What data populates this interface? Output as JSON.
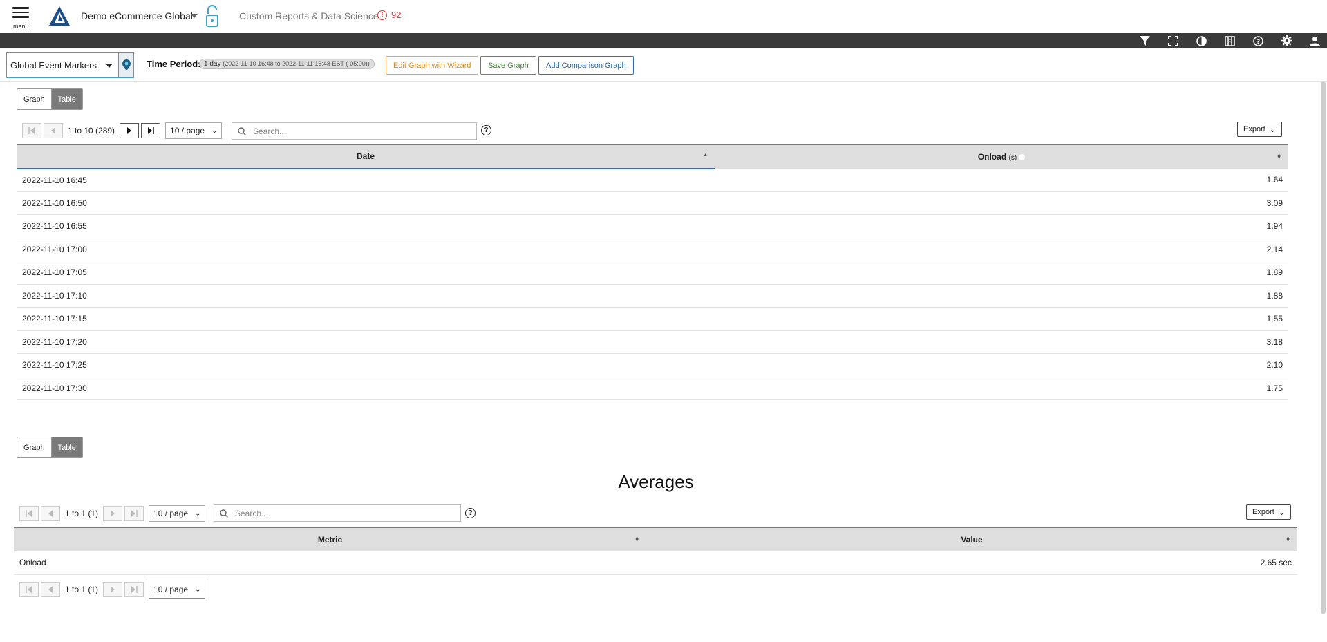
{
  "header": {
    "menu_label": "menu",
    "app_name": "Demo eCommerce Global",
    "breadcrumb": "Custom Reports & Data Science",
    "alert_count": "92"
  },
  "toolbar_icons": [
    "filter-icon",
    "fullscreen-icon",
    "contrast-icon",
    "columns-icon",
    "help-icon",
    "gear-icon",
    "user-icon"
  ],
  "controls": {
    "marker_select": "Global Event Markers",
    "time_label": "Time Period:",
    "time_value": "1 day",
    "time_range": "(2022-11-10 16:48 to 2022-11-11 16:48 EST (-05:00))",
    "edit_wizard": "Edit Graph with Wizard",
    "save_graph": "Save Graph",
    "add_comparison": "Add Comparison Graph"
  },
  "toggle": {
    "graph": "Graph",
    "table": "Table"
  },
  "table1": {
    "pager_text": "1 to 10 (289)",
    "per_page": "10 / page",
    "search_placeholder": "Search...",
    "export": "Export",
    "columns": [
      "Date",
      "Onload",
      "(s)"
    ],
    "rows": [
      [
        "2022-11-10 16:45",
        "1.64"
      ],
      [
        "2022-11-10 16:50",
        "3.09"
      ],
      [
        "2022-11-10 16:55",
        "1.94"
      ],
      [
        "2022-11-10 17:00",
        "2.14"
      ],
      [
        "2022-11-10 17:05",
        "1.89"
      ],
      [
        "2022-11-10 17:10",
        "1.88"
      ],
      [
        "2022-11-10 17:15",
        "1.55"
      ],
      [
        "2022-11-10 17:20",
        "3.18"
      ],
      [
        "2022-11-10 17:25",
        "2.10"
      ],
      [
        "2022-11-10 17:30",
        "1.75"
      ]
    ]
  },
  "averages": {
    "title": "Averages",
    "pager_text": "1 to 1 (1)",
    "per_page": "10 / page",
    "search_placeholder": "Search...",
    "export": "Export",
    "columns": [
      "Metric",
      "Value"
    ],
    "rows": [
      [
        "Onload",
        "2.65 sec"
      ]
    ],
    "bottom_pager_text": "1 to 1 (1)",
    "bottom_per_page": "10 / page"
  }
}
